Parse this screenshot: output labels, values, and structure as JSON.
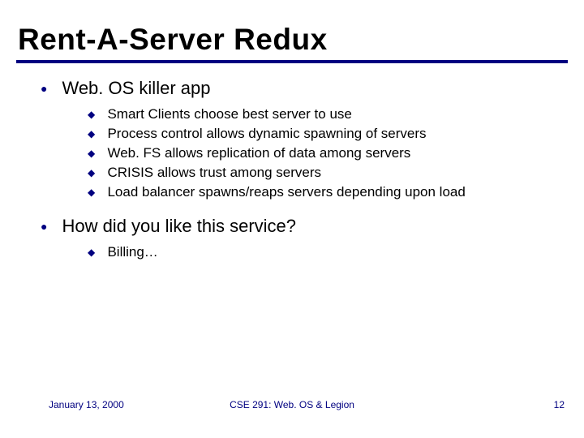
{
  "title": "Rent-A-Server Redux",
  "bullets": [
    {
      "text": "Web. OS killer app",
      "sub": [
        "Smart Clients choose best server to use",
        "Process control allows dynamic spawning of servers",
        "Web. FS allows replication of data among servers",
        "CRISIS allows trust among servers",
        "Load balancer spawns/reaps servers depending upon load"
      ]
    },
    {
      "text": "How did you like this service?",
      "sub": [
        "Billing…"
      ]
    }
  ],
  "footer": {
    "date": "January 13, 2000",
    "center": "CSE 291: Web. OS & Legion",
    "page": "12"
  },
  "glyphs": {
    "lvl1": "●",
    "lvl2": "◆"
  }
}
